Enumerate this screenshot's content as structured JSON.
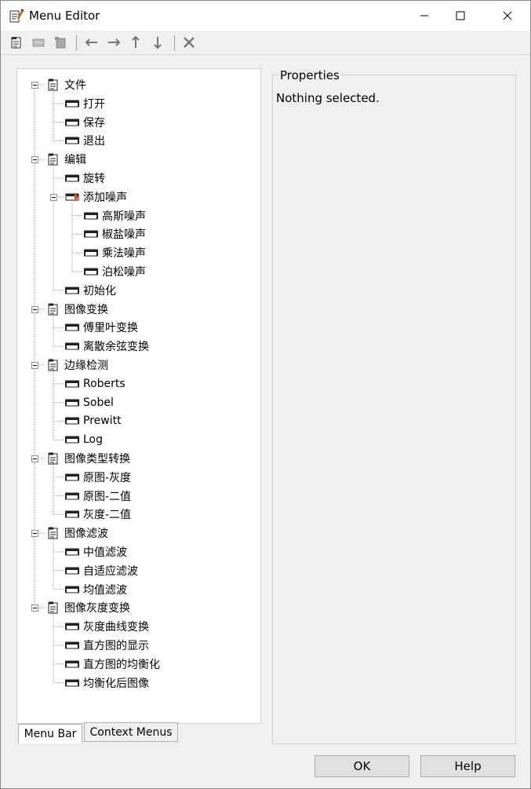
{
  "window": {
    "title": "Menu Editor",
    "controls": {
      "minimize": "minimize",
      "maximize": "maximize",
      "close": "close"
    }
  },
  "toolbar": {
    "tools": [
      {
        "name": "new-menu-icon",
        "enabled": true
      },
      {
        "name": "new-menu-item-icon",
        "enabled": false
      },
      {
        "name": "new-context-menu-icon",
        "enabled": false
      },
      {
        "name": "move-left-icon",
        "enabled": true
      },
      {
        "name": "move-right-icon",
        "enabled": true
      },
      {
        "name": "move-up-icon",
        "enabled": true
      },
      {
        "name": "move-down-icon",
        "enabled": true
      },
      {
        "name": "delete-icon",
        "enabled": true
      }
    ]
  },
  "tree": {
    "nodes": [
      {
        "label": "文件",
        "level": 0,
        "type": "menu"
      },
      {
        "label": "打开",
        "level": 1,
        "type": "item"
      },
      {
        "label": "保存",
        "level": 1,
        "type": "item"
      },
      {
        "label": "退出",
        "level": 1,
        "type": "item"
      },
      {
        "label": "编辑",
        "level": 0,
        "type": "menu"
      },
      {
        "label": "旋转",
        "level": 1,
        "type": "item"
      },
      {
        "label": "添加噪声",
        "level": 1,
        "type": "submenu"
      },
      {
        "label": "高斯噪声",
        "level": 2,
        "type": "item"
      },
      {
        "label": "椒盐噪声",
        "level": 2,
        "type": "item"
      },
      {
        "label": "乘法噪声",
        "level": 2,
        "type": "item"
      },
      {
        "label": "泊松噪声",
        "level": 2,
        "type": "item"
      },
      {
        "label": "初始化",
        "level": 1,
        "type": "item"
      },
      {
        "label": "图像变换",
        "level": 0,
        "type": "menu"
      },
      {
        "label": "傅里叶变换",
        "level": 1,
        "type": "item"
      },
      {
        "label": "离散余弦变换",
        "level": 1,
        "type": "item"
      },
      {
        "label": "边缘检测",
        "level": 0,
        "type": "menu"
      },
      {
        "label": "Roberts",
        "level": 1,
        "type": "item"
      },
      {
        "label": "Sobel",
        "level": 1,
        "type": "item"
      },
      {
        "label": "Prewitt",
        "level": 1,
        "type": "item"
      },
      {
        "label": "Log",
        "level": 1,
        "type": "item"
      },
      {
        "label": "图像类型转换",
        "level": 0,
        "type": "menu"
      },
      {
        "label": "原图-灰度",
        "level": 1,
        "type": "item"
      },
      {
        "label": "原图-二值",
        "level": 1,
        "type": "item"
      },
      {
        "label": "灰度-二值",
        "level": 1,
        "type": "item"
      },
      {
        "label": "图像滤波",
        "level": 0,
        "type": "menu"
      },
      {
        "label": "中值滤波",
        "level": 1,
        "type": "item"
      },
      {
        "label": "自适应滤波",
        "level": 1,
        "type": "item"
      },
      {
        "label": "均值滤波",
        "level": 1,
        "type": "item"
      },
      {
        "label": "图像灰度变换",
        "level": 0,
        "type": "menu"
      },
      {
        "label": "灰度曲线变换",
        "level": 1,
        "type": "item"
      },
      {
        "label": "直方图的显示",
        "level": 1,
        "type": "item"
      },
      {
        "label": "直方图的均衡化",
        "level": 1,
        "type": "item"
      },
      {
        "label": "均衡化后图像",
        "level": 1,
        "type": "item"
      }
    ]
  },
  "tabs": [
    {
      "label": "Menu Bar",
      "active": true
    },
    {
      "label": "Context Menus",
      "active": false
    }
  ],
  "properties": {
    "legend": "Properties",
    "message": "Nothing selected."
  },
  "buttons": {
    "ok": "OK",
    "help": "Help"
  }
}
